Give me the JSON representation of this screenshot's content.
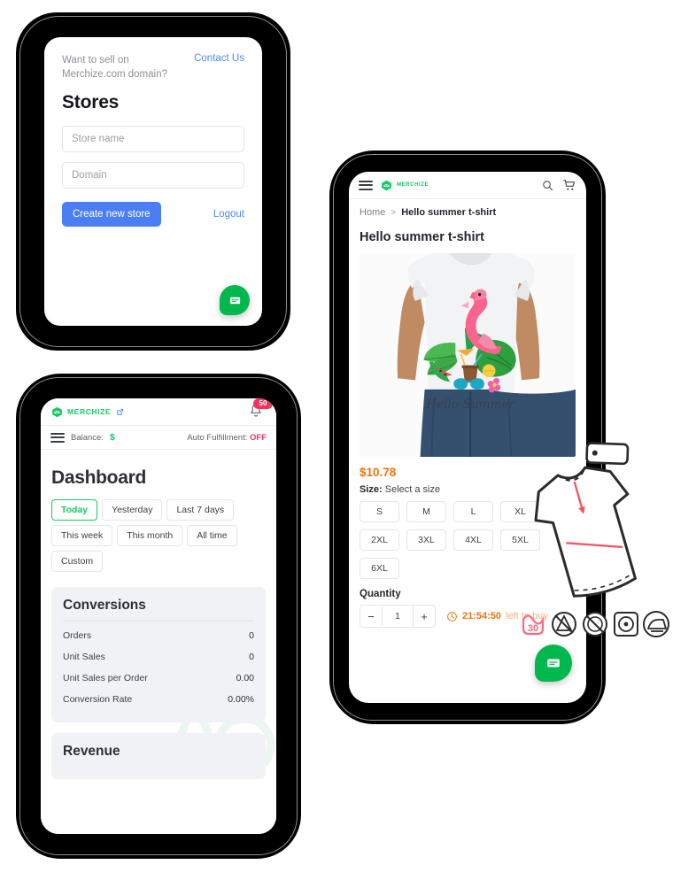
{
  "stores_screen": {
    "promo_text": "Want to sell on Merchize.com domain?",
    "contact_link": "Contact Us",
    "title": "Stores",
    "store_name_placeholder": "Store name",
    "store_name_value": "",
    "domain_placeholder": "Domain",
    "domain_value": "",
    "create_button": "Create new store",
    "logout_link": "Logout",
    "chat_icon": "chat-bubble-icon",
    "link_color": "#4c8bf5",
    "button_color": "#4c7ef3"
  },
  "dashboard_screen": {
    "brand": "MERCHIZE",
    "brand_color": "#18c964",
    "external_link_icon": "external-link-icon",
    "bell_icon": "bell-icon",
    "notification_count": "50",
    "notification_color": "#f5325c",
    "menu_icon": "hamburger-menu-icon",
    "balance_label": "Balance:",
    "balance_value": "$",
    "auto_fulfillment_label": "Auto Fulfillment:",
    "auto_fulfillment_value": "OFF",
    "title": "Dashboard",
    "range_chips": [
      {
        "label": "Today",
        "active": true
      },
      {
        "label": "Yesterday",
        "active": false
      },
      {
        "label": "Last 7 days",
        "active": false
      },
      {
        "label": "This week",
        "active": false
      },
      {
        "label": "This month",
        "active": false
      },
      {
        "label": "All time",
        "active": false
      },
      {
        "label": "Custom",
        "active": false
      }
    ],
    "conversions": {
      "title": "Conversions",
      "rows": [
        {
          "label": "Orders",
          "value": "0"
        },
        {
          "label": "Unit Sales",
          "value": "0"
        },
        {
          "label": "Unit Sales per Order",
          "value": "0.00"
        },
        {
          "label": "Conversion Rate",
          "value": "0.00%"
        }
      ]
    },
    "revenue": {
      "title": "Revenue"
    }
  },
  "product_screen": {
    "menu_icon": "hamburger-menu-icon",
    "brand": "MERCHIZE",
    "search_icon": "search-icon",
    "cart_icon": "shopping-cart-icon",
    "breadcrumb_home": "Home",
    "breadcrumb_separator": ">",
    "breadcrumb_current": "Hello summer t-shirt",
    "title": "Hello summer t-shirt",
    "photo_alt": "man wearing white t-shirt with flamingo tropical Hello Summer graphic",
    "photo_print_text": "Hello Summer",
    "price": "$10.78",
    "size_label": "Size:",
    "size_value": "Select a size",
    "sizes": [
      "S",
      "M",
      "L",
      "XL",
      "2XL",
      "3XL",
      "4XL",
      "5XL",
      "6XL"
    ],
    "quantity_label": "Quantity",
    "quantity_value": "1",
    "decrement_label": "−",
    "increment_label": "+",
    "timer_icon": "clock-icon",
    "timer_value": "21:54:50",
    "timer_suffix": "left to buy",
    "price_color": "#f2730d",
    "chat_icon": "chat-bubble-icon"
  },
  "decorations": {
    "sketch_alt": "t-shirt technical sketch with hangtag",
    "care_icons": [
      "wash-30-degrees-icon",
      "do-not-bleach-icon",
      "do-not-dry-clean-icon",
      "tumble-dry-icon",
      "iron-icon"
    ]
  }
}
